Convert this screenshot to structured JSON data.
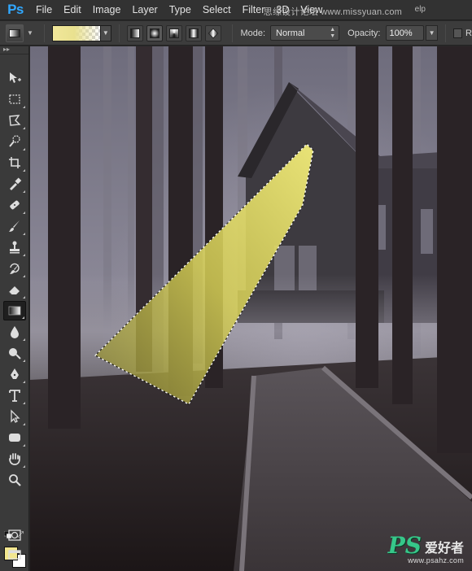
{
  "app": {
    "logo": "Ps"
  },
  "menu": [
    "File",
    "Edit",
    "Image",
    "Layer",
    "Type",
    "Select",
    "Filter",
    "3D",
    "View"
  ],
  "watermark_top": {
    "cn": "思缘设计论坛",
    "url": "www.missyuan.com",
    "tail": "elp"
  },
  "options": {
    "tool_icon": "gradient-tool-icon",
    "gradient_colors": {
      "start": "#f1e79a",
      "end": "transparent"
    },
    "gradient_types": [
      "linear",
      "radial",
      "angle",
      "reflected",
      "diamond"
    ],
    "active_gradient_type": "radial",
    "mode_label": "Mode:",
    "mode_value": "Normal",
    "opacity_label": "Opacity:",
    "opacity_value": "100%",
    "reverse_label": "R"
  },
  "toolbar": {
    "tools": [
      "move-tool-icon",
      "rectangular-marquee-icon",
      "lasso-icon",
      "quick-selection-icon",
      "crop-icon",
      "eyedropper-icon",
      "spot-healing-icon",
      "brush-icon",
      "clone-stamp-icon",
      "history-brush-icon",
      "eraser-icon",
      "gradient-icon",
      "blur-icon",
      "dodge-icon",
      "pen-icon",
      "type-icon",
      "path-selection-icon",
      "rectangle-shape-icon",
      "hand-icon",
      "zoom-icon"
    ],
    "active_tool": "gradient-icon",
    "foreground_color": "#f2e68e",
    "background_color": "#ffffff",
    "extra": [
      "quick-mask-icon",
      "screen-mode-icon"
    ]
  },
  "canvas": {
    "selection_fill": "#e6df63"
  },
  "watermark_bottom": {
    "brand": "PS",
    "cn": "爱好者",
    "url": "www.psahz.com"
  }
}
